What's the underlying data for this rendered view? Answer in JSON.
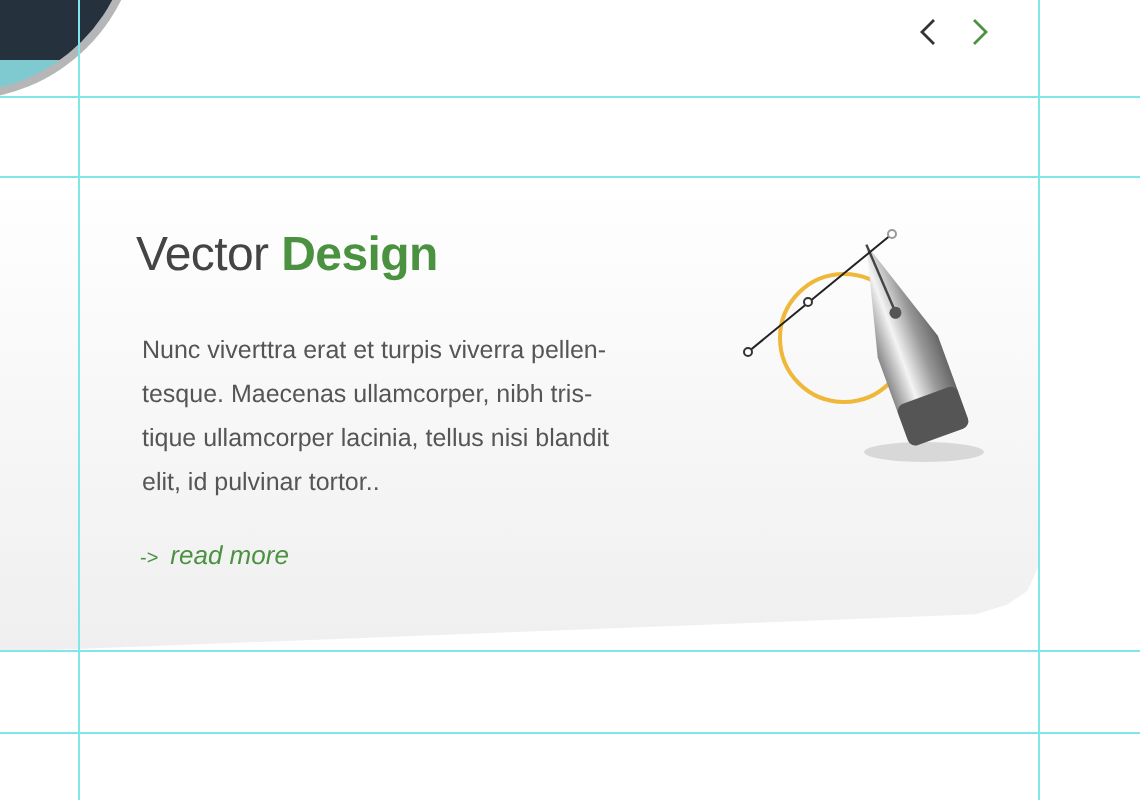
{
  "nav": [
    {
      "kind": "prev",
      "active": false
    },
    {
      "kind": "next",
      "active": true
    }
  ],
  "feature": {
    "title": "Vector **Design**",
    "body_lines": [
      "Nunc viverttra erat et turpis viverra pellen-",
      "tesque. Maecenas ullamcorper, nibh tris-",
      "tique ullamcorper lacinia, tellus nisi blandit",
      "elit, id pulvinar tortor.."
    ],
    "link": {
      "arrow": "->",
      "label": "read more"
    }
  }
}
